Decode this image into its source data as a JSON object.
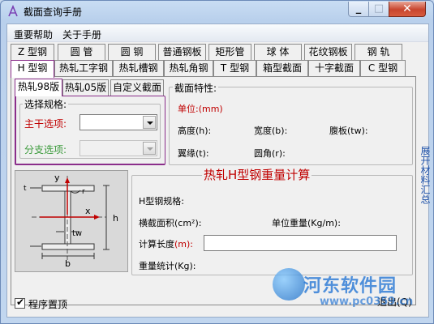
{
  "window": {
    "title": "截面查询手册"
  },
  "menubar": {
    "items": [
      "重要帮助",
      "关于手册"
    ]
  },
  "tabs_row1": [
    "Z 型钢",
    "圆  管",
    "圆  钢",
    "普通钢板",
    "矩形管",
    "球  体",
    "花纹钢板",
    "钢  轨"
  ],
  "tabs_row2": [
    "H 型钢",
    "热轧工字钢",
    "热轧槽钢",
    "热轧角钢",
    "T 型钢",
    "箱型截面",
    "十字截面",
    "C 型钢"
  ],
  "subtabs": [
    "热轧98版",
    "热轧05版",
    "自定义截面"
  ],
  "select_group": {
    "title": "选择规格:",
    "main_label": "主干选项:",
    "branch_label": "分支选项:",
    "main_value": "",
    "branch_value": ""
  },
  "properties": {
    "title": "截面特性:",
    "unit": "单位:(mm)",
    "height": "高度(h):",
    "width": "宽度(b):",
    "web": "腹板(tw):",
    "flange": "翼缘(t):",
    "fillet": "圆角(r):"
  },
  "diagram": {
    "y": "y",
    "x": "x",
    "h": "h",
    "b": "b",
    "tw": "tw",
    "t": "t",
    "r": "r"
  },
  "weight_calc": {
    "heading": "热轧H型钢重量计算",
    "spec": "H型钢规格:",
    "area": "横截面积(cm²):",
    "unit_weight": "单位重量(Kg/m):",
    "length_prefix": "计算长度",
    "length_unit": "(m):",
    "length_value": "",
    "total": "重量统计(Kg):"
  },
  "side_label": "展开材料汇总",
  "topmost_label": "程序置顶",
  "exit_label": "退出(Q)",
  "watermark": {
    "name": "河东软件园",
    "url": "www.pc0359.cn"
  },
  "colors": {
    "accent_purple": "#8b2e8b",
    "red": "#c00000",
    "green": "#3a9a3a",
    "side_blue": "#1b4fa8"
  }
}
